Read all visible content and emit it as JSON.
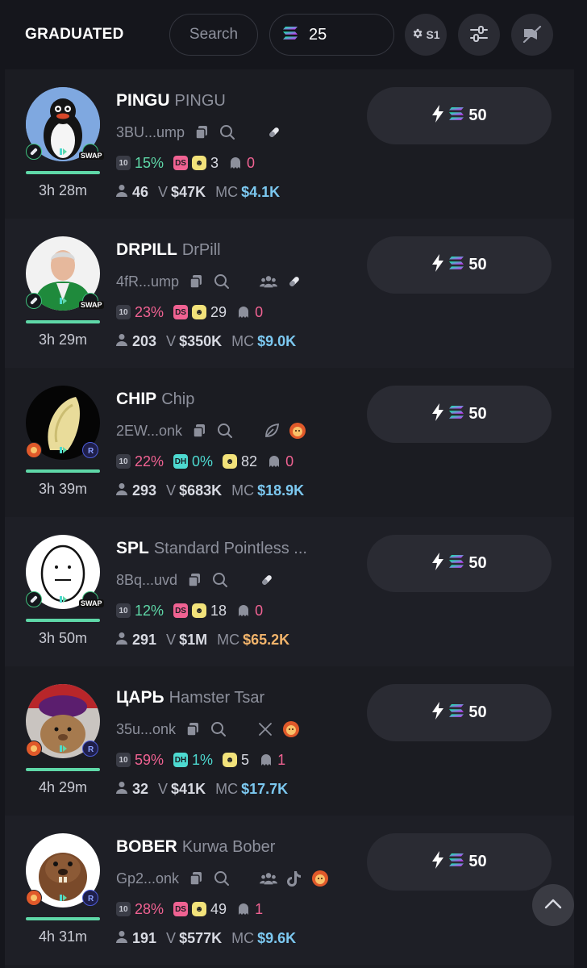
{
  "header": {
    "title": "GRADUATED",
    "search_placeholder": "Search",
    "amount": "25",
    "preset_label": "S1"
  },
  "buy_amount": "50",
  "tokens": [
    {
      "ticker": "PINGU",
      "name": "PINGU",
      "address": "3BU...ump",
      "age": "3h 28m",
      "top10": "15%",
      "dev_badge": "DS",
      "dev_pct": "",
      "smile_count": "3",
      "ghost_count": "0",
      "holders": "46",
      "volume": "$47K",
      "mc": "$4.1K",
      "socials": [
        "pill-icon"
      ],
      "left_badge": "pill",
      "right_badge": "swap"
    },
    {
      "ticker": "DRPILL",
      "name": "DrPill",
      "address": "4fR...ump",
      "age": "3h 29m",
      "top10": "23%",
      "dev_badge": "DS",
      "dev_pct": "",
      "smile_count": "29",
      "ghost_count": "0",
      "holders": "203",
      "volume": "$350K",
      "mc": "$9.0K",
      "socials": [
        "community-icon",
        "pill-icon"
      ],
      "left_badge": "pill",
      "right_badge": "swap"
    },
    {
      "ticker": "CHIP",
      "name": "Chip",
      "address": "2EW...onk",
      "age": "3h 39m",
      "top10": "22%",
      "dev_badge": "DH",
      "dev_pct": "0%",
      "smile_count": "82",
      "ghost_count": "0",
      "holders": "293",
      "volume": "$683K",
      "mc": "$18.9K",
      "socials": [
        "leaf-icon",
        "bonk-icon"
      ],
      "left_badge": "fire",
      "right_badge": "ray"
    },
    {
      "ticker": "SPL",
      "name": "Standard Pointless ...",
      "address": "8Bq...uvd",
      "age": "3h 50m",
      "top10": "12%",
      "dev_badge": "DS",
      "dev_pct": "",
      "smile_count": "18",
      "ghost_count": "0",
      "holders": "291",
      "volume": "$1M",
      "mc": "$65.2K",
      "socials": [
        "pill-icon"
      ],
      "left_badge": "pill",
      "right_badge": "swap"
    },
    {
      "ticker": "ЦАРЬ",
      "name": "Hamster Tsar",
      "address": "35u...onk",
      "age": "4h 29m",
      "top10": "59%",
      "dev_badge": "DH",
      "dev_pct": "1%",
      "smile_count": "5",
      "ghost_count": "1",
      "holders": "32",
      "volume": "$41K",
      "mc": "$17.7K",
      "socials": [
        "x-icon",
        "bonk-icon"
      ],
      "left_badge": "fire",
      "right_badge": "ray"
    },
    {
      "ticker": "BOBER",
      "name": "Kurwa Bober",
      "address": "Gp2...onk",
      "age": "4h 31m",
      "top10": "28%",
      "dev_badge": "DS",
      "dev_pct": "",
      "smile_count": "49",
      "ghost_count": "1",
      "holders": "191",
      "volume": "$577K",
      "mc": "$9.6K",
      "socials": [
        "community-icon",
        "tiktok-icon",
        "bonk-icon"
      ],
      "left_badge": "fire",
      "right_badge": "ray"
    }
  ],
  "colors": {
    "accent_green": "#5fd8a8",
    "accent_pink": "#f06292",
    "accent_cyan": "#4dd9d0",
    "mc_blue": "#7cc8f0",
    "mc_gold": "#f2b46b"
  }
}
